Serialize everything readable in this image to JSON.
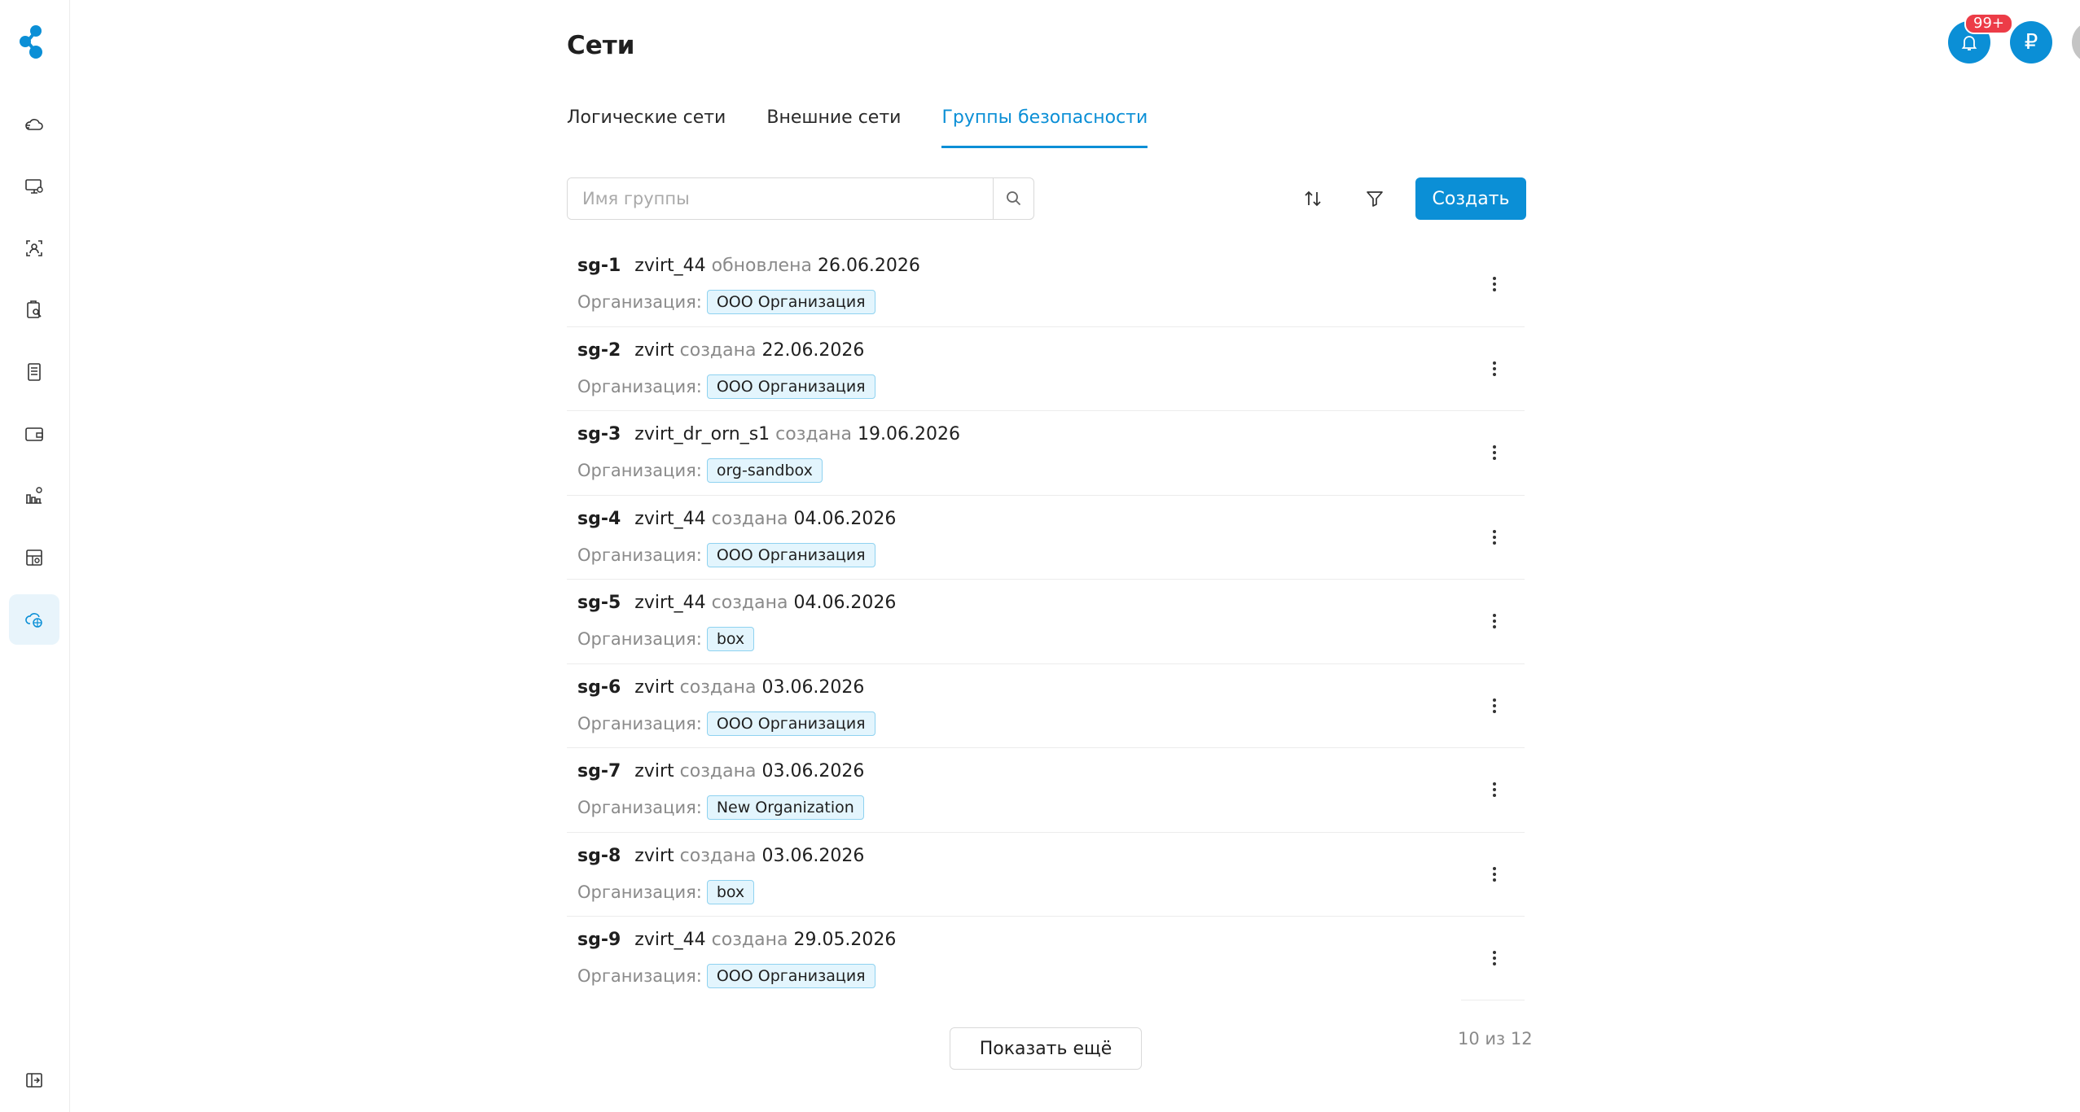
{
  "header": {
    "title": "Сети",
    "notification_badge": "99+",
    "currency_symbol": "₽"
  },
  "tabs": [
    {
      "label": "Логические сети",
      "active": false
    },
    {
      "label": "Внешние сети",
      "active": false
    },
    {
      "label": "Группы безопасности",
      "active": true
    }
  ],
  "search": {
    "placeholder": "Имя группы",
    "value": ""
  },
  "toolbar": {
    "create_label": "Создать"
  },
  "list": {
    "org_label": "Организация:",
    "items": [
      {
        "name": "sg-1",
        "owner": "zvirt_44",
        "action": "обновлена",
        "date": "26.06.2026",
        "org": "ООО Организация"
      },
      {
        "name": "sg-2",
        "owner": "zvirt",
        "action": "создана",
        "date": "22.06.2026",
        "org": "ООО Организация"
      },
      {
        "name": "sg-3",
        "owner": "zvirt_dr_orn_s1",
        "action": "создана",
        "date": "19.06.2026",
        "org": "org-sandbox"
      },
      {
        "name": "sg-4",
        "owner": "zvirt_44",
        "action": "создана",
        "date": "04.06.2026",
        "org": "ООО Организация"
      },
      {
        "name": "sg-5",
        "owner": "zvirt_44",
        "action": "создана",
        "date": "04.06.2026",
        "org": "box"
      },
      {
        "name": "sg-6",
        "owner": "zvirt",
        "action": "создана",
        "date": "03.06.2026",
        "org": "ООО Организация"
      },
      {
        "name": "sg-7",
        "owner": "zvirt",
        "action": "создана",
        "date": "03.06.2026",
        "org": "New Organization"
      },
      {
        "name": "sg-8",
        "owner": "zvirt",
        "action": "создана",
        "date": "03.06.2026",
        "org": "box"
      },
      {
        "name": "sg-9",
        "owner": "zvirt_44",
        "action": "создана",
        "date": "29.05.2026",
        "org": "ООО Организация"
      }
    ]
  },
  "footer": {
    "show_more_label": "Показать ещё",
    "counter": "10 из 12"
  },
  "colors": {
    "accent": "#0b8fd6",
    "badge": "#ec3c47",
    "tag_bg": "#e3f5fd",
    "tag_border": "#8fd2f0"
  },
  "sidebar": {
    "icons": [
      "cloud-upload-icon",
      "monitor-settings-icon",
      "scan-user-icon",
      "clipboard-search-icon",
      "document-list-icon",
      "wallet-icon",
      "chart-settings-icon",
      "dashboard-settings-icon",
      "cloud-network-icon"
    ],
    "collapse_icon": "sidebar-collapse-icon"
  }
}
